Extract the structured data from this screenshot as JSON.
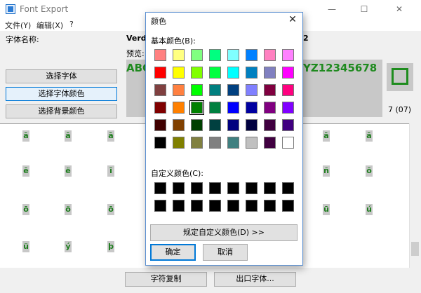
{
  "window": {
    "title": "Font Export",
    "min_glyph": "—",
    "max_glyph": "☐",
    "close_glyph": "✕"
  },
  "menu": [
    "文件(Y)",
    "编辑(X)",
    "?"
  ],
  "font_panel": {
    "font_name_label": "字体名称:",
    "font_name_value": "Verda",
    "font_name_tail": "2",
    "preview_label": "预览:",
    "preview_text_left": "ABC",
    "preview_text_right": "YZ12345678",
    "select_font_btn": "选择字体",
    "select_color_btn": "选择字体颜色",
    "select_bg_btn": "选择背景颜色",
    "char_index": "7 (07)",
    "swatch_color": "#1e8c1e"
  },
  "glyph_grid": {
    "rows": [
      [
        "ā",
        "ā",
        "ā",
        "",
        "",
        "",
        "",
        "ā",
        "ā"
      ],
      [
        "ē",
        "ë",
        "ī",
        "",
        "",
        "",
        "",
        "ñ",
        "ō"
      ],
      [
        "ō",
        "ö",
        "ō",
        "",
        "",
        "",
        "",
        "ū",
        "ú"
      ],
      [
        "ü",
        "ý",
        "þ",
        "",
        "",
        "",
        "",
        "",
        ""
      ]
    ]
  },
  "bottom": {
    "copy_btn": "字符复制",
    "export_btn": "出口字体..."
  },
  "color_dialog": {
    "title": "颜色",
    "close_glyph": "✕",
    "basic_label": "基本颜色(B):",
    "custom_label": "自定义颜色(C):",
    "define_btn": "规定自定义颜色(D) >>",
    "ok_btn": "确定",
    "cancel_btn": "取消",
    "basic_colors": [
      [
        "#ff8080",
        "#ffff80",
        "#80ff80",
        "#00ff80",
        "#80ffff",
        "#0080ff",
        "#ff80c0",
        "#ff80ff"
      ],
      [
        "#ff0000",
        "#ffff00",
        "#80ff00",
        "#00ff40",
        "#00ffff",
        "#0080c0",
        "#8080c0",
        "#ff00ff"
      ],
      [
        "#804040",
        "#ff8040",
        "#00ff00",
        "#008080",
        "#004080",
        "#8080ff",
        "#800040",
        "#ff0080"
      ],
      [
        "#800000",
        "#ff8000",
        "#008000",
        "#008040",
        "#0000ff",
        "#0000a0",
        "#800080",
        "#8000ff"
      ],
      [
        "#400000",
        "#804000",
        "#004000",
        "#004040",
        "#000080",
        "#000040",
        "#400040",
        "#400080"
      ],
      [
        "#000000",
        "#808000",
        "#808040",
        "#808080",
        "#408080",
        "#c0c0c0",
        "#400040",
        "#ffffff"
      ]
    ],
    "selected": {
      "row": 3,
      "col": 2
    },
    "custom_rows": 2,
    "custom_cols": 8
  }
}
